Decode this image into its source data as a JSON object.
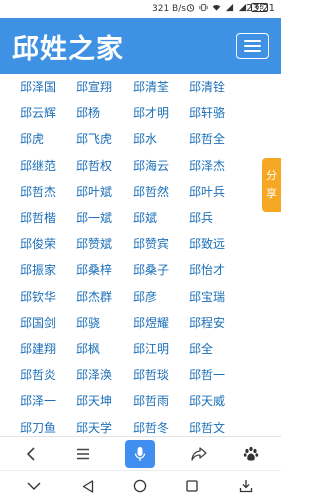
{
  "status_bar": {
    "network_speed": "321 B/s",
    "battery": "65",
    "time": "23:21"
  },
  "header": {
    "logo": "邱姓之家"
  },
  "names": [
    [
      "邱泽国",
      "邱宣翔",
      "邱清荃",
      "邱清铨"
    ],
    [
      "邱云辉",
      "邱杨",
      "邱才明",
      "邱轩骆"
    ],
    [
      "邱虎",
      "邱飞虎",
      "邱水",
      "邱哲全"
    ],
    [
      "邱继范",
      "邱哲权",
      "邱海云",
      "邱泽杰"
    ],
    [
      "邱哲杰",
      "邱叶斌",
      "邱哲然",
      "邱叶兵"
    ],
    [
      "邱哲楷",
      "邱一斌",
      "邱斌",
      "邱兵"
    ],
    [
      "邱俊荣",
      "邱赞斌",
      "邱赞宾",
      "邱致远"
    ],
    [
      "邱振家",
      "邱桑梓",
      "邱桑子",
      "邱怡才"
    ],
    [
      "邱钦华",
      "邱杰群",
      "邱彦",
      "邱宝瑞"
    ],
    [
      "邱国剑",
      "邱骁",
      "邱煜耀",
      "邱程安"
    ],
    [
      "邱建翔",
      "邱枫",
      "邱江明",
      "邱全"
    ],
    [
      "邱哲炎",
      "邱泽涣",
      "邱哲琰",
      "邱哲一"
    ],
    [
      "邱泽一",
      "邱天坤",
      "邱哲雨",
      "邱天威"
    ],
    [
      "邱刀鱼",
      "邱天学",
      "邱哲冬",
      "邱哲文"
    ]
  ],
  "share_tab": {
    "line1": "分",
    "line2": "享"
  },
  "colors": {
    "header_bg": "#3f92e3",
    "link": "#1b6fb8",
    "share_bg": "#f6a723",
    "mic_bg": "#3f8ef0"
  }
}
